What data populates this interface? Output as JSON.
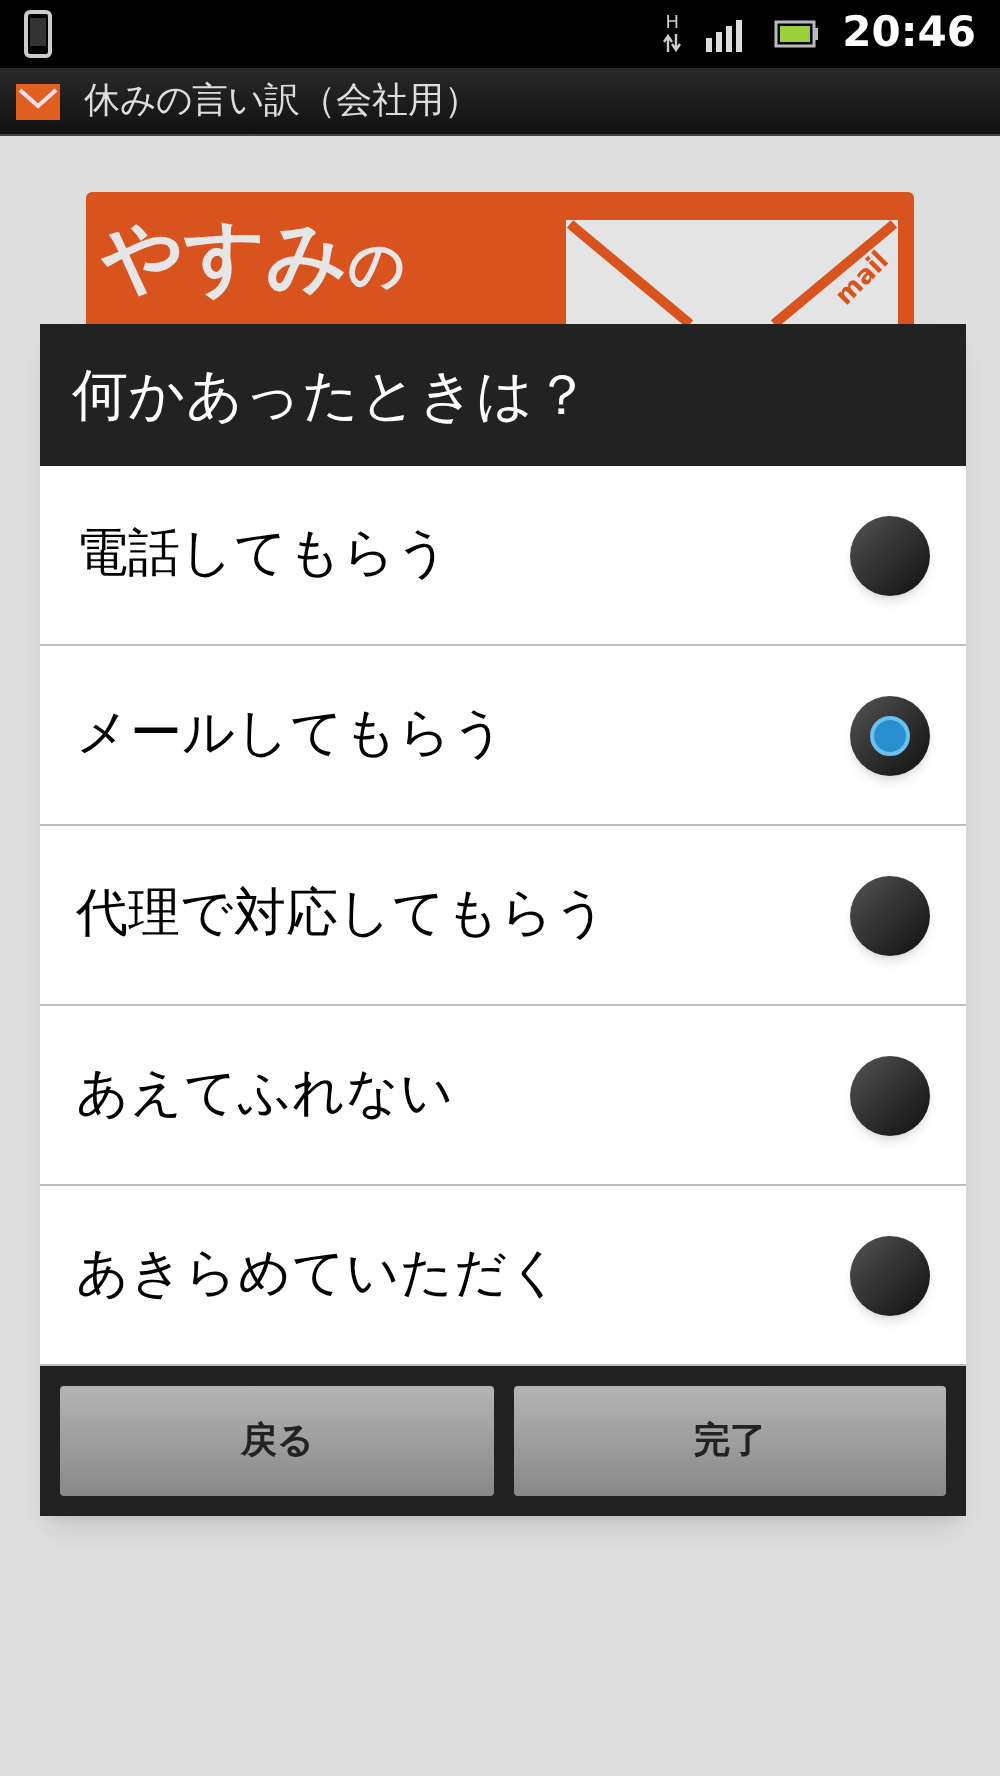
{
  "status_bar": {
    "network_type": "H",
    "time": "20:46"
  },
  "app_bar": {
    "title": "休みの言い訳（会社用）"
  },
  "logo": {
    "title": "やすみ",
    "suffix": "の",
    "tag": "mail"
  },
  "dialog": {
    "title": "何かあったときは？",
    "options": [
      {
        "label": "電話してもらう",
        "selected": false
      },
      {
        "label": "メールしてもらう",
        "selected": true
      },
      {
        "label": "代理で対応してもらう",
        "selected": false
      },
      {
        "label": "あえてふれない",
        "selected": false
      },
      {
        "label": "あきらめていただく",
        "selected": false
      }
    ],
    "buttons": [
      "戻る",
      "完了"
    ]
  }
}
